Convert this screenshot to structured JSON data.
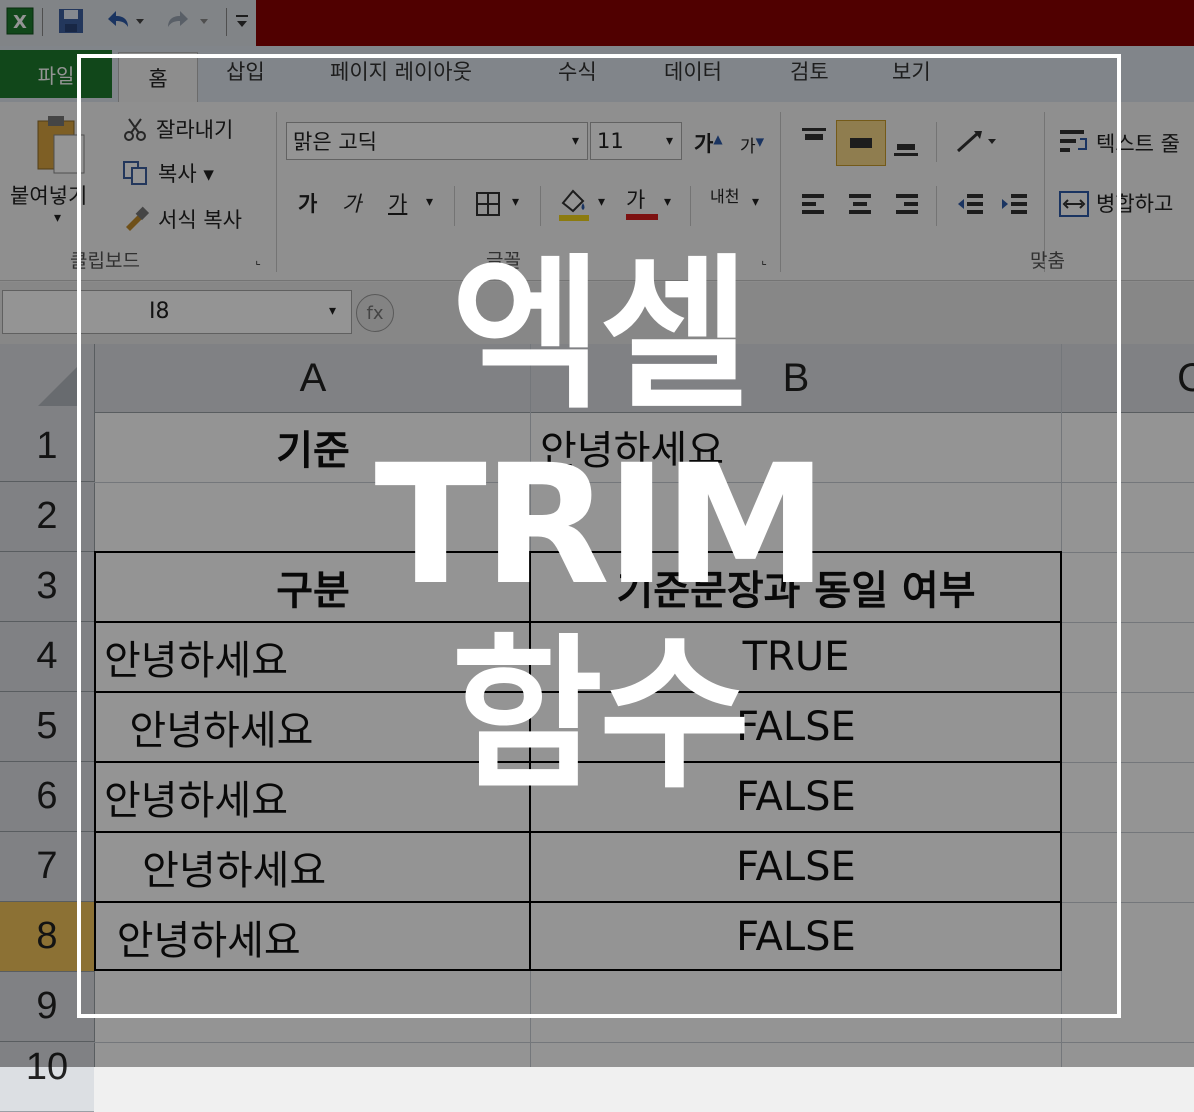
{
  "quick_access": {
    "excel_icon": "excel-icon",
    "save_icon": "save-icon",
    "undo_icon": "undo-icon",
    "redo_icon": "redo-icon",
    "customize_icon": "customize-icon"
  },
  "tabs": {
    "file": "파일",
    "home": "홈",
    "insert": "삽입",
    "page_layout": "페이지 레이아웃",
    "formulas": "수식",
    "data": "데이터",
    "review": "검토",
    "view": "보기"
  },
  "clipboard": {
    "paste": "붙여넣기",
    "cut": "잘라내기",
    "copy": "복사 ▾",
    "format_painter": "서식 복사",
    "group": "클립보드"
  },
  "font": {
    "name": "맑은 고딕",
    "size": "11",
    "bold": "가",
    "italic": "가",
    "underline": "가",
    "grow": "가",
    "shrink": "가",
    "font_color_glyph": "가",
    "phonetic": "내천",
    "group": "글꼴"
  },
  "alignment": {
    "wrap_text": "텍스트 줄",
    "merge": "병합하고",
    "group": "맞춤"
  },
  "name_box": "I8",
  "fx_label": "fx",
  "columns": [
    "A",
    "B",
    "C"
  ],
  "rows": [
    "1",
    "2",
    "3",
    "4",
    "5",
    "6",
    "7",
    "8",
    "9",
    "10"
  ],
  "cells": {
    "a1": "기준",
    "b1": "안녕하세요",
    "a3": "구분",
    "b3": "기준문장과 동일 여부",
    "a4": "안녕하세요",
    "b4": "TRUE",
    "a5": "  안녕하세요",
    "b5": "FALSE",
    "a6": "안녕하세요",
    "b6": "FALSE",
    "a7": "   안녕하세요",
    "b7": "FALSE",
    "a8": " 안녕하세요",
    "b8": "FALSE"
  },
  "overlay": {
    "line1": "엑셀",
    "line2": "TRIM",
    "line3": "함수"
  },
  "colors": {
    "file_tab": "#1e7a2e",
    "title_bar": "#8a0000",
    "selected_row_header": "#f1c35a"
  }
}
